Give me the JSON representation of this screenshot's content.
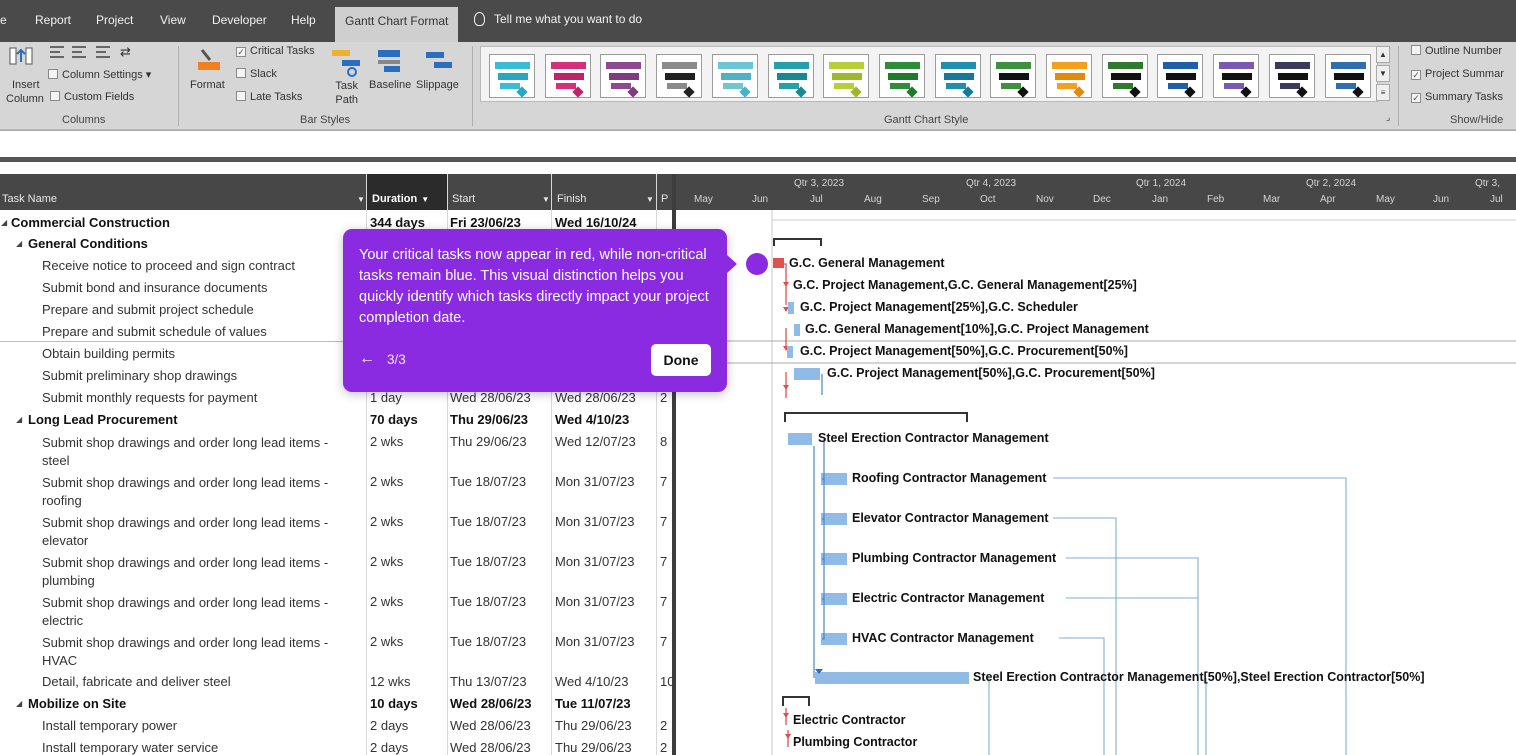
{
  "ribbon": {
    "tabs": [
      "e",
      "Report",
      "Project",
      "View",
      "Developer",
      "Help",
      "Gantt Chart Format"
    ],
    "tell_me": "Tell me what you want to do",
    "columns_group": {
      "insert_column": [
        "Insert",
        "Column"
      ],
      "column_settings": "Column Settings",
      "custom_fields": "Custom Fields",
      "label": "Columns"
    },
    "bar_styles_group": {
      "format": "Format",
      "critical_tasks": "Critical Tasks",
      "slack": "Slack",
      "late_tasks": "Late Tasks",
      "task_path": [
        "Task",
        "Path"
      ],
      "baseline": "Baseline",
      "slippage": "Slippage",
      "label": "Bar Styles"
    },
    "gantt_style_label": "Gantt Chart Style",
    "show_hide": {
      "outline_number": "Outline Number",
      "project_summary": "Project Summar",
      "summary_tasks": "Summary Tasks",
      "label": "Show/Hide"
    },
    "styles": [
      {
        "bar": "#3bbcd6",
        "dia": "#2aa7bf"
      },
      {
        "bar": "#d4317a",
        "dia": "#c02468"
      },
      {
        "bar": "#8e4a8f",
        "dia": "#7d3d7e"
      },
      {
        "bar": "#8a8a8a",
        "dia": "#222222"
      },
      {
        "bar": "#6fc6d3",
        "dia": "#4db3c3"
      },
      {
        "bar": "#26a0a8",
        "dia": "#1a8890"
      },
      {
        "bar": "#b8cf3a",
        "dia": "#9fb82a"
      },
      {
        "bar": "#2f8c3a",
        "dia": "#1f7a2b"
      },
      {
        "bar": "#1f8fb0",
        "dia": "#157a99"
      },
      {
        "bar": "#3e8f3e",
        "dia": "#111111"
      },
      {
        "bar": "#f2a020",
        "dia": "#e08a10"
      },
      {
        "bar": "#2f7a2f",
        "dia": "#111111"
      },
      {
        "bar": "#1f5fa8",
        "dia": "#111111"
      },
      {
        "bar": "#7a5ab0",
        "dia": "#111111"
      },
      {
        "bar": "#3a3a5a",
        "dia": "#111111"
      },
      {
        "bar": "#2f6fb0",
        "dia": "#111111"
      }
    ]
  },
  "table": {
    "headers": {
      "task_name": "Task Name",
      "duration": "Duration",
      "start": "Start",
      "finish": "Finish",
      "predecessors": "P"
    },
    "rows": [
      {
        "name": "Commercial Construction",
        "dur": "344 days",
        "start": "Fri 23/06/23",
        "finish": "Wed 16/10/24",
        "pred": ""
      },
      {
        "name": "General Conditions",
        "dur": "",
        "start": "",
        "finish": "",
        "pred": ""
      },
      {
        "name": "Receive notice to proceed and sign contract",
        "dur": "",
        "start": "",
        "finish": "",
        "pred": ""
      },
      {
        "name": "Submit bond and insurance documents",
        "dur": "",
        "start": "",
        "finish": "",
        "pred": ""
      },
      {
        "name": "Prepare and submit project schedule",
        "dur": "",
        "start": "",
        "finish": "",
        "pred": ""
      },
      {
        "name": "Prepare and submit schedule of values",
        "dur": "",
        "start": "",
        "finish": "",
        "pred": ""
      },
      {
        "name": "Obtain building permits",
        "dur": "",
        "start": "",
        "finish": "",
        "pred": ""
      },
      {
        "name": "Submit preliminary shop drawings",
        "dur": "",
        "start": "",
        "finish": "",
        "pred": ""
      },
      {
        "name": "Submit monthly requests for payment",
        "dur": "1 day",
        "start": "Wed 28/06/23",
        "finish": "Wed 28/06/23",
        "pred": "2"
      },
      {
        "name": "Long Lead Procurement",
        "dur": "70 days",
        "start": "Thu 29/06/23",
        "finish": "Wed 4/10/23",
        "pred": ""
      },
      {
        "name": "Submit shop drawings and order long lead items - steel",
        "dur": "2 wks",
        "start": "Thu 29/06/23",
        "finish": "Wed 12/07/23",
        "pred": "8"
      },
      {
        "name": "Submit shop drawings and order long lead items - roofing",
        "dur": "2 wks",
        "start": "Tue 18/07/23",
        "finish": "Mon 31/07/23",
        "pred": "7"
      },
      {
        "name": "Submit shop drawings and order long lead items - elevator",
        "dur": "2 wks",
        "start": "Tue 18/07/23",
        "finish": "Mon 31/07/23",
        "pred": "7"
      },
      {
        "name": "Submit shop drawings and order long lead items - plumbing",
        "dur": "2 wks",
        "start": "Tue 18/07/23",
        "finish": "Mon 31/07/23",
        "pred": "7"
      },
      {
        "name": "Submit shop drawings and order long lead items - electric",
        "dur": "2 wks",
        "start": "Tue 18/07/23",
        "finish": "Mon 31/07/23",
        "pred": "7"
      },
      {
        "name": "Submit shop drawings and order long lead items - HVAC",
        "dur": "2 wks",
        "start": "Tue 18/07/23",
        "finish": "Mon 31/07/23",
        "pred": "7"
      },
      {
        "name": "Detail, fabricate and deliver steel",
        "dur": "12 wks",
        "start": "Thu 13/07/23",
        "finish": "Wed 4/10/23",
        "pred": "10"
      },
      {
        "name": "Mobilize on Site",
        "dur": "10 days",
        "start": "Wed 28/06/23",
        "finish": "Tue 11/07/23",
        "pred": ""
      },
      {
        "name": "Install temporary power",
        "dur": "2 days",
        "start": "Wed 28/06/23",
        "finish": "Thu 29/06/23",
        "pred": "2"
      },
      {
        "name": "Install temporary water service",
        "dur": "2 days",
        "start": "Wed 28/06/23",
        "finish": "Thu 29/06/23",
        "pred": "2"
      }
    ]
  },
  "timescale": {
    "quarters": [
      "Qtr 3, 2023",
      "Qtr 4, 2023",
      "Qtr 1, 2024",
      "Qtr 2, 2024",
      "Qtr 3,"
    ],
    "months": [
      "May",
      "Jun",
      "Jul",
      "Aug",
      "Sep",
      "Oct",
      "Nov",
      "Dec",
      "Jan",
      "Feb",
      "Mar",
      "Apr",
      "May",
      "Jun",
      "Jul"
    ]
  },
  "gantt_labels": [
    "G.C. General Management",
    "G.C. Project Management,G.C. General Management[25%]",
    "G.C. Project Management[25%],G.C. Scheduler",
    "G.C. General Management[10%],G.C. Project Management",
    "G.C. Project Management[50%],G.C. Procurement[50%]",
    "G.C. Project Management[50%],G.C. Procurement[50%]",
    "Steel Erection Contractor Management",
    "Roofing Contractor Management",
    "Elevator Contractor Management",
    "Plumbing Contractor Management",
    "Electric Contractor Management",
    "HVAC Contractor Management",
    "Steel Erection Contractor Management[50%],Steel Erection Contractor[50%]",
    "Electric Contractor",
    "Plumbing Contractor"
  ],
  "colors": {
    "critical": "#e05050",
    "task_bar": "#8fbbe6",
    "tour": "#8a2be2"
  },
  "tour": {
    "message": "Your critical tasks now appear in red, while non-critical tasks remain blue. This visual distinction helps you quickly identify which tasks directly impact your project completion date.",
    "back_icon": "←",
    "counter": "3/3",
    "done_label": "Done"
  }
}
